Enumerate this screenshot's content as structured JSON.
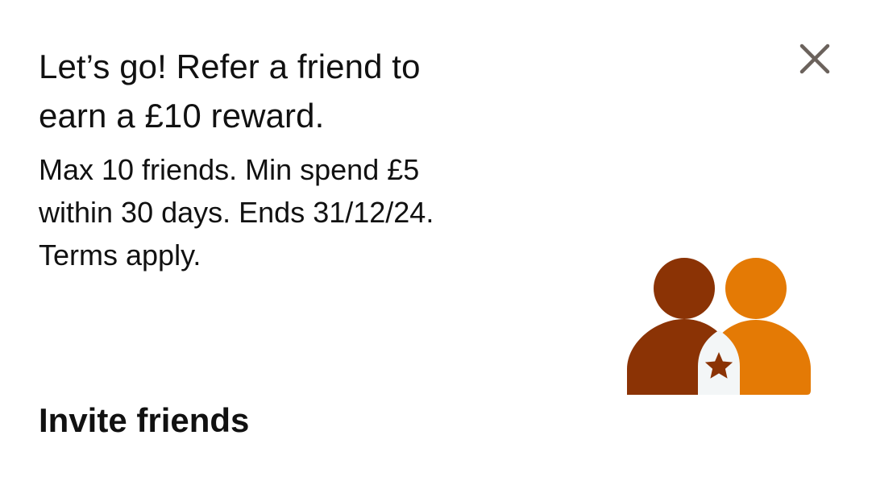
{
  "promo": {
    "headline_line1": "Let’s go! Refer a friend to",
    "headline_line2": "earn a £10 reward.",
    "body_line1": "Max 10 friends. Min spend £5",
    "body_line2": "within 30 days. Ends 31/12/24.",
    "body_line3": "Terms apply.",
    "cta_label": "Invite friends",
    "close_icon": "close-icon",
    "illustration_icon": "two-friends-star-icon"
  },
  "colors": {
    "person_left": "#8b3305",
    "person_right": "#e47a05",
    "shield": "#f3f6f7",
    "close": "#6b625c",
    "text": "#111111"
  }
}
